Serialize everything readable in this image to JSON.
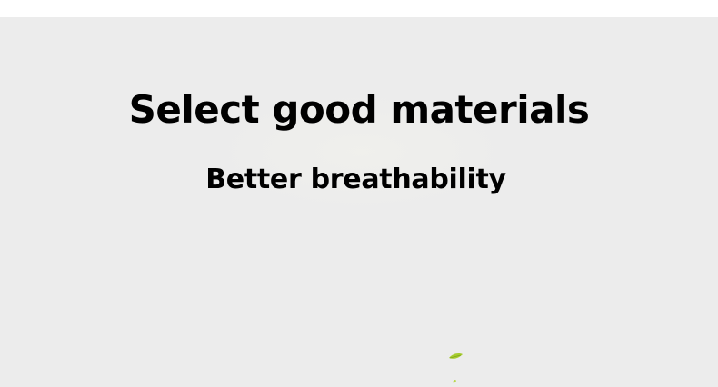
{
  "banner": {
    "headline": "Select good materials",
    "subheadline": "Better breathability"
  },
  "colors": {
    "page_background": "#ffffff",
    "banner_background": "#ececec",
    "text": "#000000",
    "leaf": "#a6cc2e"
  },
  "icons": {
    "decoration": "leaf-icon"
  }
}
